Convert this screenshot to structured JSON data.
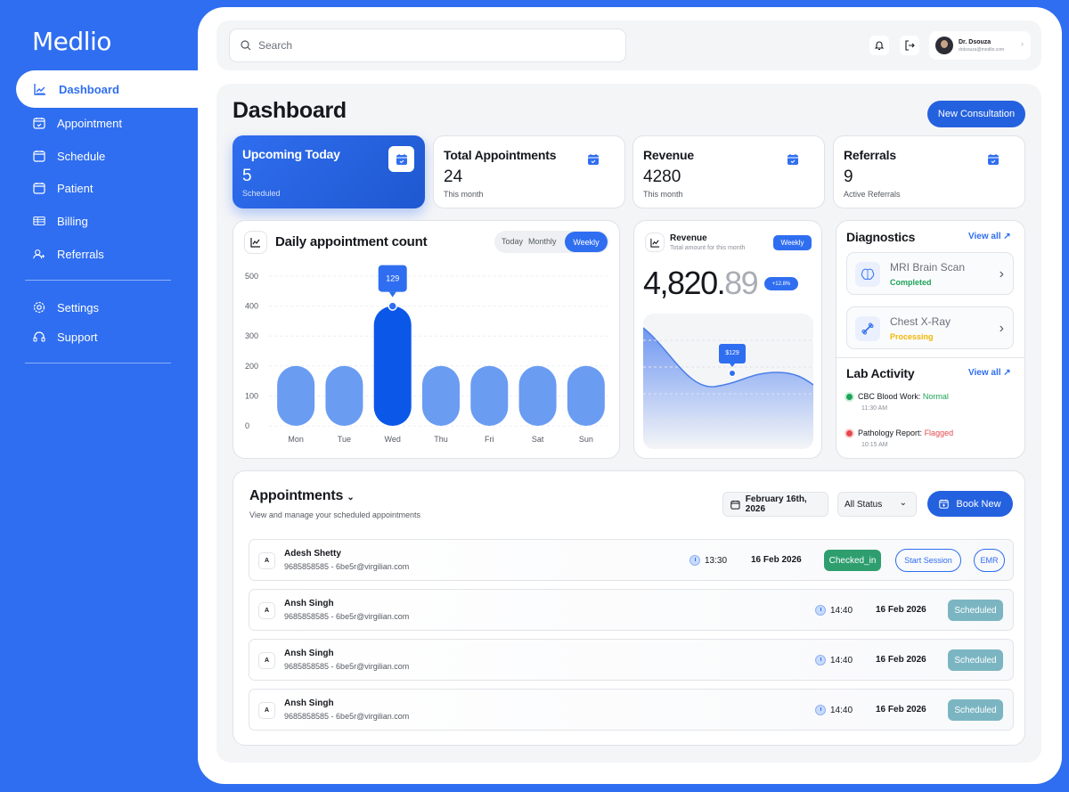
{
  "app": {
    "name": "Medlio"
  },
  "sidebar": {
    "items": [
      {
        "label": "Dashboard",
        "icon": "chart-line-icon"
      },
      {
        "label": "Appointment",
        "icon": "calendar-check-icon"
      },
      {
        "label": "Schedule",
        "icon": "calendar-icon"
      },
      {
        "label": "Patient",
        "icon": "calendar-icon"
      },
      {
        "label": "Billing",
        "icon": "billing-icon"
      },
      {
        "label": "Referrals",
        "icon": "user-plus-icon"
      }
    ],
    "bottom": [
      {
        "label": "Settings",
        "icon": "gear-icon"
      },
      {
        "label": "Support",
        "icon": "headset-icon"
      }
    ]
  },
  "header": {
    "search_placeholder": "Search",
    "user": {
      "name": "Dr. Dsouza",
      "email": "drdsouza@medlio.com"
    }
  },
  "page": {
    "title": "Dashboard",
    "new_button": "New Consultation"
  },
  "stats": [
    {
      "title": "Upcoming Today",
      "value": "5",
      "sub": "Scheduled"
    },
    {
      "title": "Total Appointments",
      "value": "24",
      "sub": "This month"
    },
    {
      "title": "Revenue",
      "value": "4280",
      "sub": "This month"
    },
    {
      "title": "Referrals",
      "value": "9",
      "sub": "Active Referrals"
    }
  ],
  "daily_chart": {
    "title": "Daily appointment count",
    "tabs": [
      "Today",
      "Monthly",
      "Weekly"
    ],
    "active_tab": "Weekly",
    "tooltip": "129"
  },
  "chart_data": {
    "type": "bar",
    "categories": [
      "Mon",
      "Tue",
      "Wed",
      "Thu",
      "Fri",
      "Sat",
      "Sun"
    ],
    "values": [
      200,
      200,
      400,
      200,
      200,
      200,
      200
    ],
    "highlight": "Wed",
    "yticks": [
      "0",
      "100",
      "200",
      "300",
      "400",
      "500"
    ],
    "ylim": [
      0,
      500
    ],
    "grid": true
  },
  "revenue_card": {
    "title": "Revenue",
    "subtitle": "Total amount for this month",
    "tab": "Weekly",
    "amount_main": "4,820.",
    "amount_decimal": "89",
    "change": "+12.8%",
    "tooltip": "$129"
  },
  "diagnostics": {
    "title": "Diagnostics",
    "view_all": "View all",
    "items": [
      {
        "name": "MRI Brain Scan",
        "status": "Completed",
        "status_color": "#1fa35a"
      },
      {
        "name": "Chest X-Ray",
        "status": "Processing",
        "status_color": "#f2b705"
      }
    ]
  },
  "lab": {
    "title": "Lab Activity",
    "view_all": "View all",
    "items": [
      {
        "label": "CBC Blood Work:",
        "result": "Normal",
        "color": "#1fa35a",
        "time": "11:30 AM"
      },
      {
        "label": "Pathology Report:",
        "result": "Flagged",
        "color": "#e5484d",
        "time": "10:15 AM"
      }
    ]
  },
  "appointments": {
    "title": "Appointments",
    "subtitle": "View and manage your scheduled appointments",
    "date": "February 16th, 2026",
    "status_filter": "All Status",
    "book_button": "Book New",
    "rows": [
      {
        "initial": "A",
        "name": "Adesh Shetty",
        "contact": "9685858585 - 6be5r@virgilian.com",
        "time": "13:30",
        "date": "16 Feb 2026",
        "status": "Checked_in",
        "actions": [
          "Start Session",
          "EMR"
        ]
      },
      {
        "initial": "A",
        "name": "Ansh Singh",
        "contact": "9685858585 - 6be5r@virgilian.com",
        "time": "14:40",
        "date": "16 Feb 2026",
        "status": "Scheduled"
      },
      {
        "initial": "A",
        "name": "Ansh Singh",
        "contact": "9685858585 - 6be5r@virgilian.com",
        "time": "14:40",
        "date": "16 Feb 2026",
        "status": "Scheduled"
      },
      {
        "initial": "A",
        "name": "Ansh Singh",
        "contact": "9685858585 - 6be5r@virgilian.com",
        "time": "14:40",
        "date": "16 Feb 2026",
        "status": "Scheduled"
      }
    ]
  },
  "colors": {
    "primary": "#2f6ef0",
    "background": "#f4f5f7",
    "success": "#1fa35a",
    "warning": "#f2b705",
    "danger": "#e5484d"
  }
}
